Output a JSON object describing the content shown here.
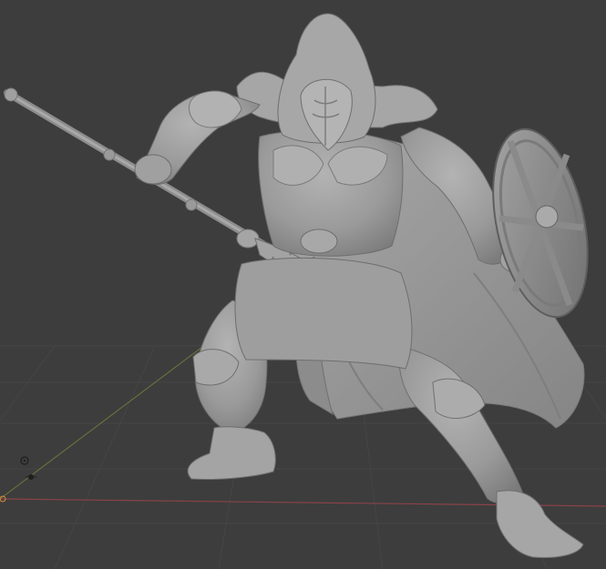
{
  "viewport": {
    "background_color": "#3d3d3d",
    "grid_color": "#454545",
    "x_axis_color": "#8a4248",
    "y_axis_color": "#6a7a3c",
    "model_base_color": "#9a9a9a",
    "model_shadow_color": "#6e6e6e",
    "model_highlight_color": "#b8b8b8"
  },
  "model": {
    "subject": "hooded-warrior-sculpt",
    "parts": [
      "hood",
      "mask",
      "cloak",
      "staff-spear",
      "shield",
      "armor",
      "boots"
    ]
  },
  "gizmos": [
    "3d-cursor-icon",
    "light-icon"
  ]
}
